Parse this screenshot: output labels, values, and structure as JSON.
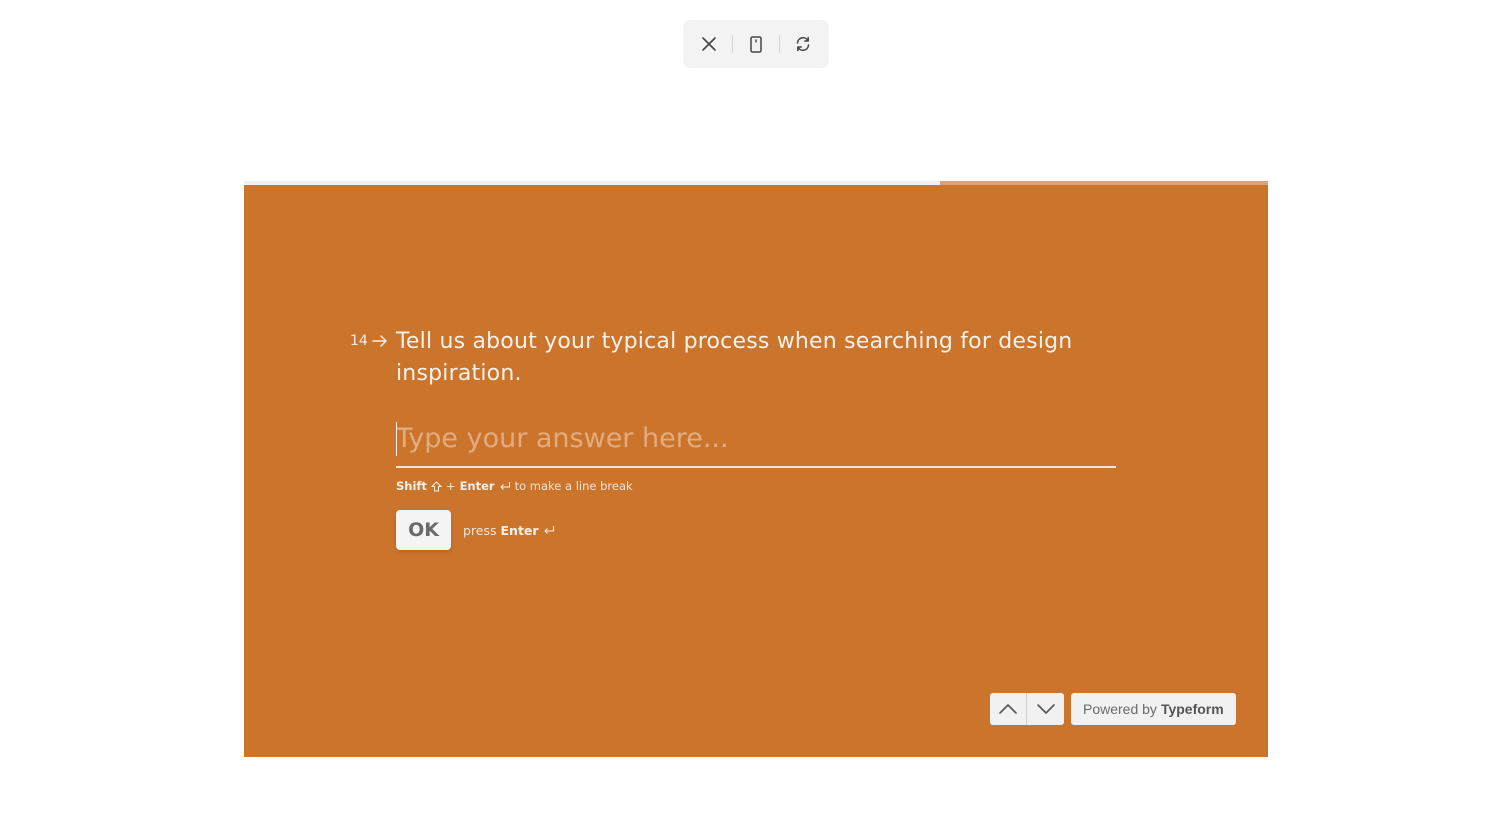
{
  "toolbar": {
    "icons": [
      "close-icon",
      "mobile-preview-icon",
      "refresh-icon"
    ]
  },
  "form": {
    "background_color": "#cb742c",
    "progress": 0.68,
    "question": {
      "number": "14",
      "text": "Tell us about your typical process when searching for design inspiration."
    },
    "answer": {
      "value": "",
      "placeholder": "Type your answer here..."
    },
    "hint": {
      "shift": "Shift",
      "plus": "+",
      "enter": "Enter",
      "suffix": "to make a line break"
    },
    "ok_button": "OK",
    "press_hint": {
      "prefix": "press",
      "key": "Enter"
    }
  },
  "footer": {
    "powered_prefix": "Powered by",
    "powered_brand": "Typeform"
  }
}
